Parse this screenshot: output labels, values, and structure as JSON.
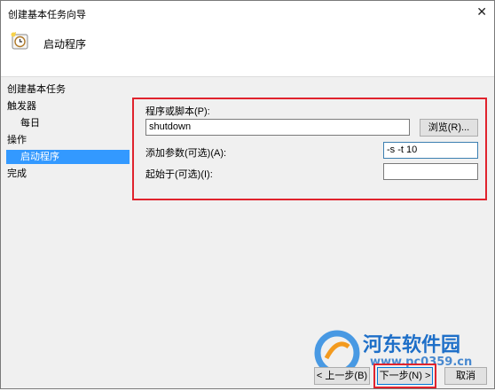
{
  "window": {
    "title": "创建基本任务向导",
    "close_glyph": "✕"
  },
  "header": {
    "title": "启动程序",
    "icon": "task-clock-icon"
  },
  "steps": [
    {
      "label": "创建基本任务",
      "level": "main",
      "active": false
    },
    {
      "label": "触发器",
      "level": "main",
      "active": false
    },
    {
      "label": "每日",
      "level": "sub",
      "active": false
    },
    {
      "label": "操作",
      "level": "main",
      "active": false
    },
    {
      "label": "启动程序",
      "level": "sub",
      "active": true
    },
    {
      "label": "完成",
      "level": "main",
      "active": false
    }
  ],
  "form": {
    "program_label": "程序或脚本(P):",
    "program_value": "shutdown",
    "browse_label": "浏览(R)...",
    "args_label": "添加参数(可选)(A):",
    "args_value": "-s -t 10",
    "startin_label": "起始于(可选)(I):",
    "startin_value": ""
  },
  "buttons": {
    "back": "< 上一步(B)",
    "next": "下一步(N) >",
    "cancel": "取消"
  },
  "watermark": {
    "name": "河东软件园",
    "url": "www.pc0359.cn"
  },
  "colors": {
    "highlight_red": "#e0232d",
    "selection_blue": "#3399ff",
    "panel_gray": "#f0f0f0"
  }
}
